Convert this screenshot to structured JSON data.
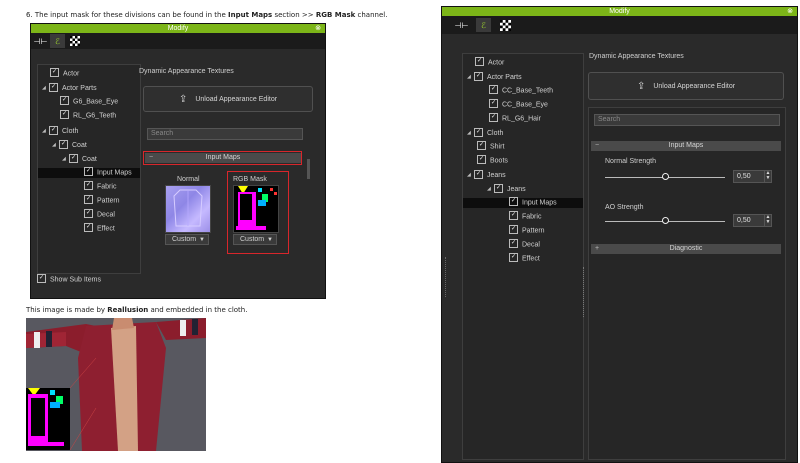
{
  "doc": {
    "step_prefix": "6. The input mask for these divisions can be found in the ",
    "step_bold1": "Input Maps",
    "step_mid": " section >> ",
    "step_bold2": "RGB Mask",
    "step_suffix": " channel.",
    "note_prefix": "This image is made by ",
    "note_bold": "Reallusion",
    "note_suffix": " and embedded in the cloth."
  },
  "left_panel": {
    "title": "Modify",
    "dyn_label": "Dynamic Appearance Textures",
    "unload_label": "Unload Appearance Editor",
    "search_placeholder": "Search",
    "section_label": "Input Maps",
    "tex1_label": "Normal",
    "tex2_label": "RGB Mask",
    "custom1": "Custom",
    "custom2": "Custom",
    "show_sub": "Show Sub Items",
    "tree": [
      {
        "label": "Actor"
      },
      {
        "label": "Actor Parts"
      },
      {
        "label": "G6_Base_Eye"
      },
      {
        "label": "RL_G6_Teeth"
      },
      {
        "label": "Cloth"
      },
      {
        "label": "Coat"
      },
      {
        "label": "Coat"
      },
      {
        "label": "Input Maps"
      },
      {
        "label": "Fabric"
      },
      {
        "label": "Pattern"
      },
      {
        "label": "Decal"
      },
      {
        "label": "Effect"
      }
    ]
  },
  "right_panel": {
    "title": "Modify",
    "dyn_label": "Dynamic Appearance Textures",
    "unload_label": "Unload Appearance Editor",
    "search_placeholder": "Search",
    "section_label": "Input Maps",
    "normal_strength_label": "Normal Strength",
    "normal_strength_value": "0,50",
    "ao_strength_label": "AO Strength",
    "ao_strength_value": "0,50",
    "diagnostic_label": "Diagnostic",
    "tree": [
      {
        "label": "Actor"
      },
      {
        "label": "Actor Parts"
      },
      {
        "label": "CC_Base_Teeth"
      },
      {
        "label": "CC_Base_Eye"
      },
      {
        "label": "RL_G6_Hair"
      },
      {
        "label": "Cloth"
      },
      {
        "label": "Shirt"
      },
      {
        "label": "Boots"
      },
      {
        "label": "Jeans"
      },
      {
        "label": "Jeans"
      },
      {
        "label": "Input Maps"
      },
      {
        "label": "Fabric"
      },
      {
        "label": "Pattern"
      },
      {
        "label": "Decal"
      },
      {
        "label": "Effect"
      }
    ]
  },
  "colors": {
    "titlebar": "#7cb518",
    "highlight_box": "#d8262b",
    "panel_bg": "#2a2a2a"
  }
}
